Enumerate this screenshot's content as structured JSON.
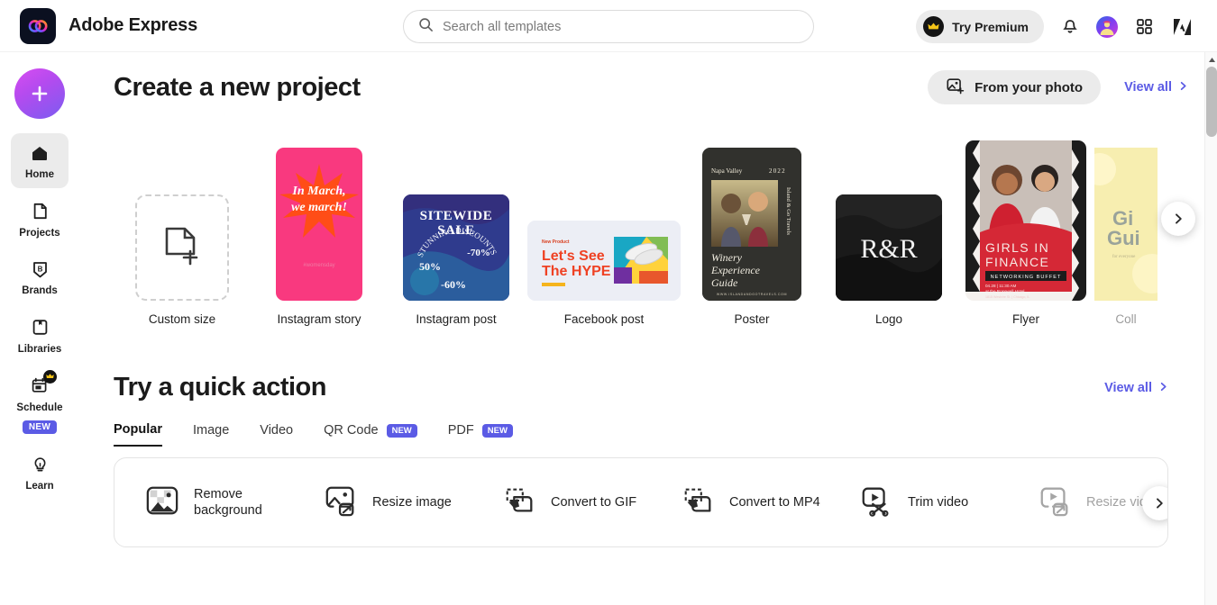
{
  "app": {
    "name": "Adobe Express",
    "logo_icon": "adobe-express-logo-icon"
  },
  "search": {
    "placeholder": "Search all templates",
    "value": "",
    "icon": "search-icon"
  },
  "topbar": {
    "premium_label": "Try Premium",
    "premium_icon": "crown-icon",
    "notifications_icon": "bell-icon",
    "avatar_icon": "user-avatar",
    "apps_icon": "app-grid-icon",
    "adobe_icon": "adobe-logo-icon"
  },
  "sidebar": {
    "create_button": {
      "label": "",
      "icon": "plus-icon"
    },
    "items": [
      {
        "label": "Home",
        "icon": "home-icon",
        "active": true,
        "badge": ""
      },
      {
        "label": "Projects",
        "icon": "file-icon",
        "active": false,
        "badge": ""
      },
      {
        "label": "Brands",
        "icon": "brand-icon",
        "active": false,
        "badge": ""
      },
      {
        "label": "Libraries",
        "icon": "library-icon",
        "active": false,
        "badge": ""
      },
      {
        "label": "Schedule",
        "icon": "calendar-icon",
        "active": false,
        "badge": "NEW"
      },
      {
        "label": "Learn",
        "icon": "bulb-icon",
        "active": false,
        "badge": ""
      }
    ]
  },
  "projects": {
    "title": "Create a new project",
    "from_photo_label": "From your photo",
    "from_photo_icon": "image-plus-icon",
    "view_all_label": "View all",
    "view_all_icon": "chevron-right-icon",
    "next_icon": "chevron-right-icon",
    "templates": [
      {
        "label": "Custom size",
        "kind": "custom"
      },
      {
        "label": "Instagram story",
        "kind": "instagram-story",
        "text": {
          "line1": "In March,",
          "line2": "we march!",
          "hashtag": "#womensday"
        }
      },
      {
        "label": "Instagram post",
        "kind": "instagram-post",
        "text": {
          "line1": "SITEWIDE",
          "line2": "SALE",
          "ring": "STUNNING DISCOUNTS",
          "d1": "-70%",
          "d2": "50%",
          "d3": "-60%"
        }
      },
      {
        "label": "Facebook post",
        "kind": "facebook-post",
        "text": {
          "eyebrow": "New Product",
          "line1": "Let's See",
          "line2": "The HYPE"
        }
      },
      {
        "label": "Poster",
        "kind": "poster",
        "text": {
          "place": "Napa Valley",
          "year": "2022",
          "side": "Island & Go Travels",
          "title1": "Winery",
          "title2": "Experience",
          "title3": "Guide",
          "url": "WWW.ISLANDANDGOTRAVELS.COM"
        }
      },
      {
        "label": "Logo",
        "kind": "logo",
        "text": {
          "monogram": "R&R"
        }
      },
      {
        "label": "Flyer",
        "kind": "flyer",
        "text": {
          "line1": "GIRLS IN",
          "line2": "FINANCE",
          "banner": "NETWORKING BUFFET",
          "date": "04.28 | 11:30 AM",
          "venue": "at the Rosewell Hotel",
          "address": "1815 Westvire St. | Chicago, IL"
        }
      },
      {
        "label": "Coll",
        "kind": "collage",
        "text": {
          "line1": "Gi",
          "line2": "Gui",
          "sub": "for everyone"
        }
      }
    ]
  },
  "quick_actions": {
    "title": "Try a quick action",
    "view_all_label": "View all",
    "view_all_icon": "chevron-right-icon",
    "next_icon": "chevron-right-icon",
    "tabs": [
      {
        "label": "Popular",
        "badge": "",
        "active": true
      },
      {
        "label": "Image",
        "badge": "",
        "active": false
      },
      {
        "label": "Video",
        "badge": "",
        "active": false
      },
      {
        "label": "QR Code",
        "badge": "NEW",
        "active": false
      },
      {
        "label": "PDF",
        "badge": "NEW",
        "active": false
      }
    ],
    "items": [
      {
        "label": "Remove background",
        "icon": "remove-background-icon",
        "dim": false
      },
      {
        "label": "Resize image",
        "icon": "resize-image-icon",
        "dim": false
      },
      {
        "label": "Convert to GIF",
        "icon": "convert-gif-icon",
        "dim": false
      },
      {
        "label": "Convert to MP4",
        "icon": "convert-mp4-icon",
        "dim": false
      },
      {
        "label": "Trim video",
        "icon": "trim-video-icon",
        "dim": false
      },
      {
        "label": "Resize video",
        "icon": "resize-video-icon",
        "dim": true
      }
    ]
  },
  "colors": {
    "accent": "#5b5be5",
    "badge": "#5b5be5",
    "pill_bg": "#ebebeb",
    "active_nav_bg": "#ebebeb"
  }
}
